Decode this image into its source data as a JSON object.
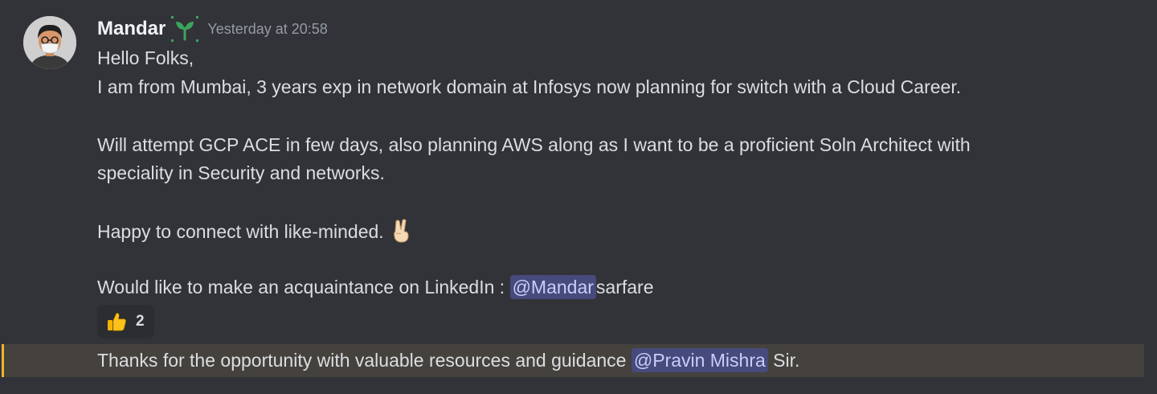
{
  "message": {
    "author": {
      "name": "Mandar",
      "badge_icon": "sprout-icon",
      "avatar_icon": "avatar-icon"
    },
    "timestamp": "Yesterday at 20:58",
    "lines": {
      "l1": "Hello Folks,",
      "l2": "I am from Mumbai, 3 years exp in network domain at Infosys now planning for switch with a Cloud Career.",
      "l3": "Will attempt GCP ACE in few days, also planning AWS along as I want to be a proficient Soln Architect with",
      "l4": "speciality in Security and networks.",
      "l5": "Happy to connect with like-minded.",
      "l6_prefix": "Would like to make an acquaintance on LinkedIn : ",
      "l6_mention": "@Mandar",
      "l6_suffix": "sarfare"
    },
    "emoji": "victory-hand-icon",
    "reaction": {
      "emoji": "thumbs-up-icon",
      "count": "2"
    }
  },
  "followup": {
    "prefix": "Thanks for the opportunity with valuable resources and guidance ",
    "mention": "@Pravin Mishra",
    "suffix": " Sir."
  },
  "colors": {
    "background": "#323338",
    "mention_bg": "#464a7c",
    "mention_text": "#c9cdfb",
    "highlight_bg": "#45423d",
    "highlight_bar": "#f0b232",
    "badge_green": "#3ba55d"
  }
}
